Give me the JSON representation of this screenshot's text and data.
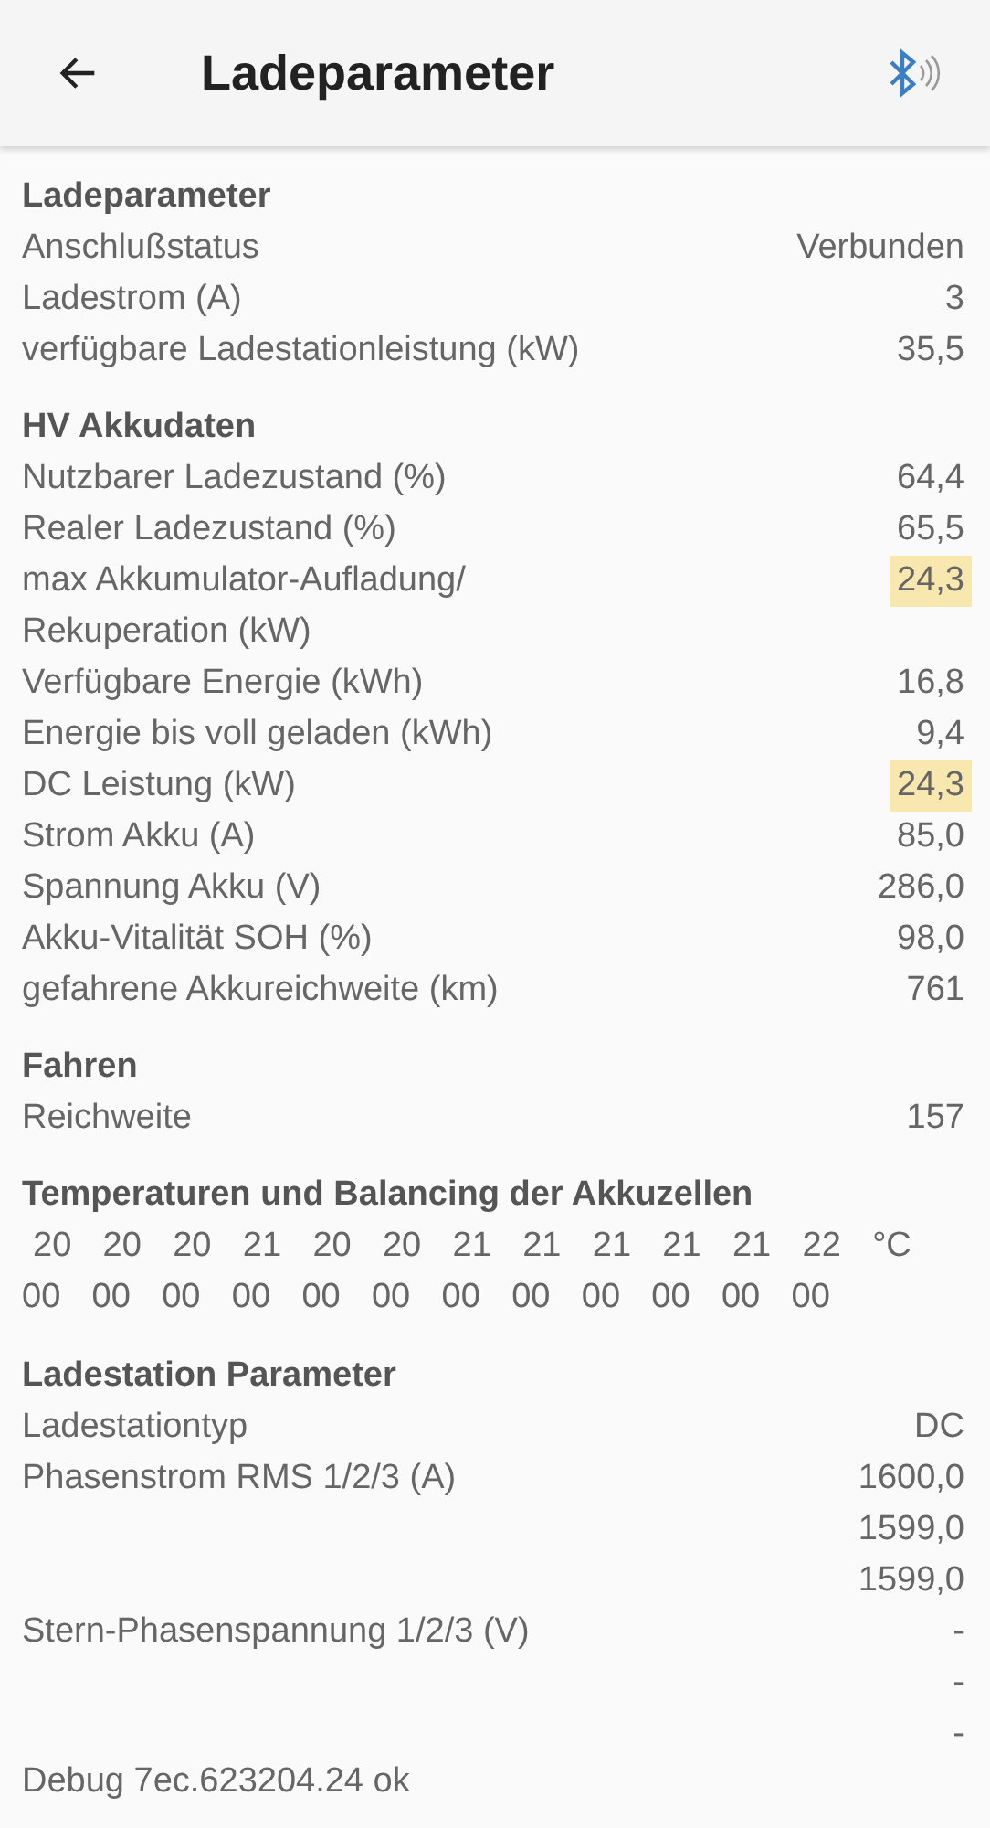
{
  "header": {
    "title": "Ladeparameter"
  },
  "sections": [
    {
      "kind": "rows",
      "title": "Ladeparameter",
      "rows": [
        {
          "label": "Anschlußstatus",
          "values": [
            "Verbunden"
          ],
          "highlighted": false
        },
        {
          "label": "Ladestrom (A)",
          "values": [
            "3"
          ],
          "highlighted": false
        },
        {
          "label": "verfügbare Ladestationleistung (kW)",
          "values": [
            "35,5"
          ],
          "highlighted": false
        }
      ]
    },
    {
      "kind": "rows",
      "title": "HV Akkudaten",
      "rows": [
        {
          "label": "Nutzbarer Ladezustand (%)",
          "values": [
            "64,4"
          ],
          "highlighted": false
        },
        {
          "label": "Realer Ladezustand (%)",
          "values": [
            "65,5"
          ],
          "highlighted": false
        },
        {
          "label": "max Akkumulator-Aufladung/\nRekuperation (kW)",
          "values": [
            "24,3"
          ],
          "highlighted": true
        },
        {
          "label": "Verfügbare Energie (kWh)",
          "values": [
            "16,8"
          ],
          "highlighted": false
        },
        {
          "label": "Energie bis voll geladen (kWh)",
          "values": [
            "9,4"
          ],
          "highlighted": false
        },
        {
          "label": "DC Leistung (kW)",
          "values": [
            "24,3"
          ],
          "highlighted": true
        },
        {
          "label": "Strom Akku (A)",
          "values": [
            "85,0"
          ],
          "highlighted": false
        },
        {
          "label": "Spannung Akku (V)",
          "values": [
            "286,0"
          ],
          "highlighted": false
        },
        {
          "label": "Akku-Vitalität SOH (%)",
          "values": [
            "98,0"
          ],
          "highlighted": false
        },
        {
          "label": "gefahrene Akkureichweite (km)",
          "values": [
            "761"
          ],
          "highlighted": false
        }
      ]
    },
    {
      "kind": "rows",
      "title": "Fahren",
      "rows": [
        {
          "label": "Reichweite",
          "values": [
            "157"
          ],
          "highlighted": false
        }
      ]
    },
    {
      "kind": "cells",
      "title": "Temperaturen und Balancing der Akkuzellen",
      "temperatures": [
        "20",
        "20",
        "20",
        "21",
        "20",
        "20",
        "21",
        "21",
        "21",
        "21",
        "21",
        "22"
      ],
      "unit": "°C",
      "balancing": [
        "00",
        "00",
        "00",
        "00",
        "00",
        "00",
        "00",
        "00",
        "00",
        "00",
        "00",
        "00"
      ]
    },
    {
      "kind": "rows",
      "title": "Ladestation Parameter",
      "rows": [
        {
          "label": "Ladestationtyp",
          "values": [
            "DC"
          ],
          "highlighted": false
        },
        {
          "label": "Phasenstrom RMS 1/2/3 (A)",
          "values": [
            "1600,0",
            "1599,0",
            "1599,0"
          ],
          "highlighted": false
        },
        {
          "label": "Stern-Phasenspannung 1/2/3 (V)",
          "values": [
            "-",
            "-",
            "-"
          ],
          "highlighted": false
        }
      ]
    }
  ],
  "debug": "Debug 7ec.623204.24 ok"
}
